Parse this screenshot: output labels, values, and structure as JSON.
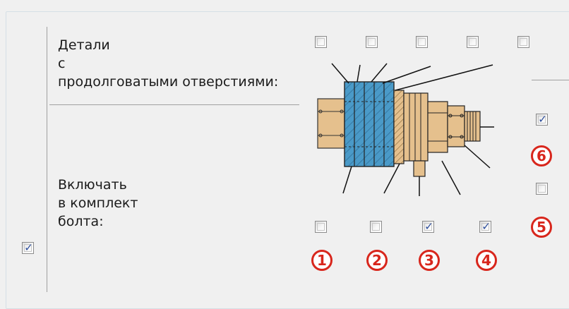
{
  "labels": {
    "slotted_line1": "Детали",
    "slotted_line2": "с",
    "slotted_line3": "продолговатыми отверстиями:",
    "include_line1": "Включать",
    "include_line2": "в комплект",
    "include_line3": "болта:"
  },
  "checkboxes": {
    "row_enable": {
      "checked": true
    },
    "slotted": [
      {
        "checked": false
      },
      {
        "checked": false
      },
      {
        "checked": false
      },
      {
        "checked": false
      },
      {
        "checked": false
      }
    ],
    "include": [
      {
        "checked": false
      },
      {
        "checked": false
      },
      {
        "checked": true
      },
      {
        "checked": true
      }
    ],
    "item6": {
      "checked": true
    },
    "item5": {
      "checked": false
    }
  },
  "markers": [
    "1",
    "2",
    "3",
    "4",
    "5",
    "6"
  ],
  "colors": {
    "marker_red": "#d8261c",
    "check_blue": "#2b4c9b",
    "plate_blue": "#4a9ac8",
    "metal_tan": "#e5c08d",
    "background": "#f0f0f0"
  },
  "check_glyph": "✓"
}
